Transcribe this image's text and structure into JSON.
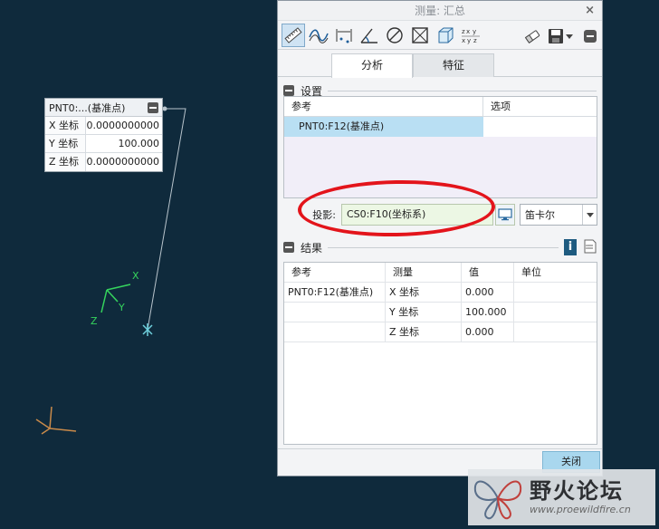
{
  "viewport": {
    "info_box": {
      "title": "PNT0:...(基准点)",
      "rows": [
        {
          "label": "X 坐标",
          "value": "0.0000000000"
        },
        {
          "label": "Y 坐标",
          "value": "100.000"
        },
        {
          "label": "Z 坐标",
          "value": "0.0000000000"
        }
      ]
    },
    "triad": {
      "x": "X",
      "y": "Y",
      "z": "Z"
    }
  },
  "dialog": {
    "title": "测量: 汇总",
    "close_symbol": "×",
    "toolbar": {
      "tools": [
        "ruler-icon",
        "curve-length-icon",
        "distance-icon",
        "angle-icon",
        "diameter-icon",
        "area-icon",
        "volume-icon",
        "transform-icon"
      ],
      "right": [
        "eraser-icon",
        "save-icon"
      ]
    },
    "tabs": [
      "分析",
      "特征"
    ],
    "settings": {
      "section_title": "设置",
      "table_headers": [
        "参考",
        "选项"
      ],
      "reference_row": "PNT0:F12(基准点)",
      "projection_label": "投影:",
      "projection_value": "CS0:F10(坐标系)",
      "coord_select": "笛卡尔"
    },
    "results": {
      "section_title": "结果",
      "headers": [
        "参考",
        "测量",
        "值",
        "单位"
      ],
      "rows": [
        {
          "ref": "PNT0:F12(基准点)",
          "measure": "X 坐标",
          "value": "0.000",
          "unit": ""
        },
        {
          "ref": "",
          "measure": "Y 坐标",
          "value": "100.000",
          "unit": ""
        },
        {
          "ref": "",
          "measure": "Z 坐标",
          "value": "0.000",
          "unit": ""
        }
      ]
    },
    "close_button": "关闭"
  },
  "watermark": {
    "title": "野火论坛",
    "url": "www.proewildfire.cn"
  },
  "colors": {
    "background": "#0f2a3c",
    "highlight": "#e3141b",
    "selection": "#b9dff3",
    "projection_field": "#ecf7e4"
  }
}
